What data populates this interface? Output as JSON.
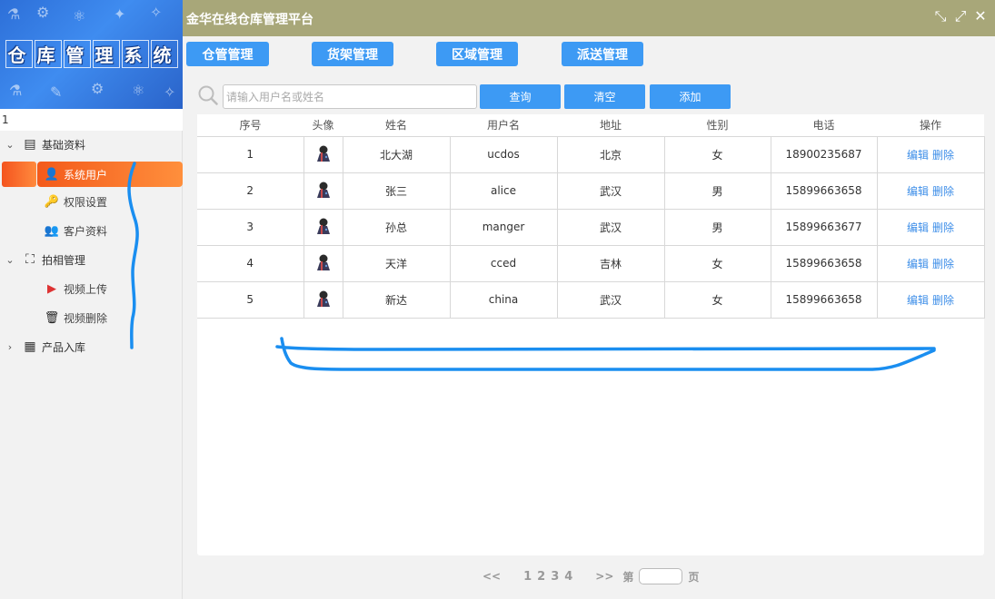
{
  "sidebar": {
    "logo_chars": [
      "仓",
      "库",
      "管",
      "理",
      "系",
      "统"
    ],
    "search_value": "1",
    "groups": [
      {
        "label": "基础资料",
        "expanded": true,
        "icon": "address-book-icon",
        "items": [
          {
            "label": "系统用户",
            "icon": "user-icon",
            "active": true
          },
          {
            "label": "权限设置",
            "icon": "user-key-icon"
          },
          {
            "label": "客户资料",
            "icon": "users-icon"
          }
        ]
      },
      {
        "label": "拍相管理",
        "expanded": true,
        "icon": "camera-frame-icon",
        "items": [
          {
            "label": "视频上传",
            "icon": "video-camera-icon"
          },
          {
            "label": "视频删除",
            "icon": "trash-icon"
          }
        ]
      },
      {
        "label": "产品入库",
        "expanded": false,
        "icon": "warehouse-icon"
      }
    ]
  },
  "header": {
    "title": "金华在线仓库管理平台",
    "accent": "#a8a779"
  },
  "nav": [
    "仓管管理",
    "货架管理",
    "区域管理",
    "派送管理"
  ],
  "search": {
    "placeholder": "请输入用户名或姓名",
    "query_label": "查询",
    "clear_label": "清空",
    "add_label": "添加"
  },
  "table": {
    "columns": [
      "序号",
      "头像",
      "姓名",
      "用户名",
      "地址",
      "性别",
      "电话",
      "操作"
    ],
    "edit_label": "编辑",
    "delete_label": "删除",
    "rows": [
      {
        "no": "1",
        "name": "北大湖",
        "username": "ucdos",
        "address": "北京",
        "gender": "女",
        "phone": "18900235687"
      },
      {
        "no": "2",
        "name": "张三",
        "username": "alice",
        "address": "武汉",
        "gender": "男",
        "phone": "15899663658"
      },
      {
        "no": "3",
        "name": "孙总",
        "username": "manger",
        "address": "武汉",
        "gender": "男",
        "phone": "15899663677"
      },
      {
        "no": "4",
        "name": "天洋",
        "username": "cced",
        "address": "吉林",
        "gender": "女",
        "phone": "15899663658"
      },
      {
        "no": "5",
        "name": "新达",
        "username": "china",
        "address": "武汉",
        "gender": "女",
        "phone": "15899663658"
      }
    ]
  },
  "pager": {
    "prev": "<<",
    "pages": [
      "1",
      "2",
      "3",
      "4"
    ],
    "next": ">>",
    "page_prefix": "第",
    "page_suffix": "页"
  },
  "colors": {
    "primary_button": "#3d9af4",
    "active_item": "#f35a1b",
    "link": "#3d8ee8"
  }
}
